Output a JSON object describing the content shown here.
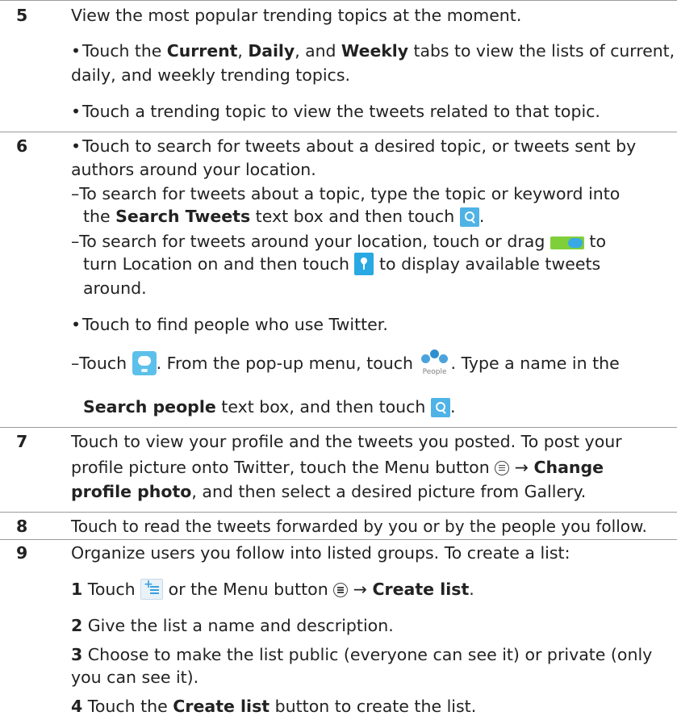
{
  "rows": [
    {
      "number": "5",
      "intro": "View the most popular trending topics at the moment.",
      "b1_pre": "Touch the ",
      "b1_current": "Current",
      "b1_c1": ", ",
      "b1_daily": "Daily",
      "b1_and": ", and ",
      "b1_weekly": "Weekly",
      "b1_post": " tabs to view the lists of current,",
      "b1_line2": "daily, and weekly trending topics.",
      "b2": "Touch a trending topic to view the tweets related to that topic."
    },
    {
      "number": "6",
      "b1_line1": "Touch to search for tweets about a desired topic, or tweets sent by",
      "b1_line2": "authors around your location.",
      "d1_line1": "–To search for tweets about a topic, type the topic or keyword into",
      "d1_pre": "the ",
      "d1_bold": "Search Tweets",
      "d1_post": " text box and then touch ",
      "d1_end": ".",
      "d2_pre": "–To search for tweets around your location, touch or drag ",
      "d2_post": " to",
      "d2_line2_pre": "turn Location on and then touch ",
      "d2_line2_post": " to display available tweets",
      "d2_line3": "around.",
      "b2": "Touch to find people who use Twitter.",
      "d3_pre": "–Touch ",
      "d3_mid": ". From the pop-up menu, touch ",
      "d3_post": ". Type a name in the",
      "people_label": "People",
      "d3_bold": "Search people",
      "d3_line2_post": " text box, and then touch ",
      "d3_end": "."
    },
    {
      "number": "7",
      "line1": "Touch to view your profile and the tweets you posted. To post your",
      "line2_pre": "profile picture onto Twitter, touch the Menu button ",
      "line2_arrow": "→ ",
      "line2_bold": "Change",
      "line3_bold": "profile photo",
      "line3_post": ", and then select a desired picture from Gallery."
    },
    {
      "number": "8",
      "line1": "Touch to read the tweets forwarded by you or by the people you follow."
    },
    {
      "number": "9",
      "intro": "Organize users you follow into listed groups. To create a list:",
      "s1_num": "1",
      "s1_pre": " Touch ",
      "s1_mid": " or the Menu button ",
      "s1_arrow": "→ ",
      "s1_bold": "Create list",
      "s1_end": ".",
      "s2_num": "2",
      "s2_text": " Give the list a name and description.",
      "s3_num": "3",
      "s3_line1": " Choose to make the list public (everyone can see it) or private (only",
      "s3_line2": "you can see it).",
      "s4_num": "4",
      "s4_pre": " Touch the ",
      "s4_bold": "Create list",
      "s4_post": " button to create the list."
    }
  ]
}
